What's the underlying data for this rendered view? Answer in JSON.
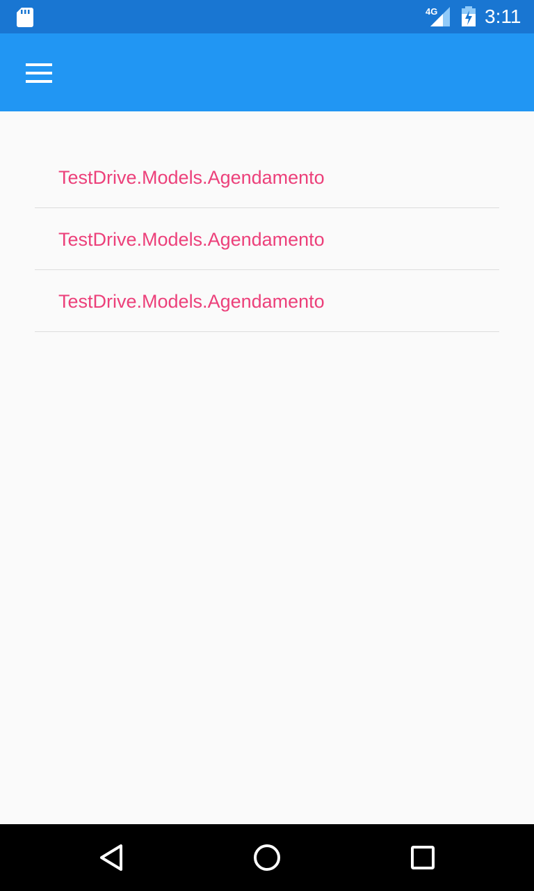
{
  "status_bar": {
    "network": "4G",
    "time": "3:11",
    "icons": [
      "sd-card-icon",
      "signal-icon",
      "battery-charging-icon"
    ]
  },
  "app_bar": {
    "menu_icon": "hamburger-menu-icon",
    "color": "#2196F3"
  },
  "list": {
    "items": [
      {
        "label": "TestDrive.Models.Agendamento"
      },
      {
        "label": "TestDrive.Models.Agendamento"
      },
      {
        "label": "TestDrive.Models.Agendamento"
      }
    ],
    "text_color": "#EC407A"
  },
  "nav_bar": {
    "icons": [
      "back-icon",
      "home-icon",
      "recents-icon"
    ]
  }
}
